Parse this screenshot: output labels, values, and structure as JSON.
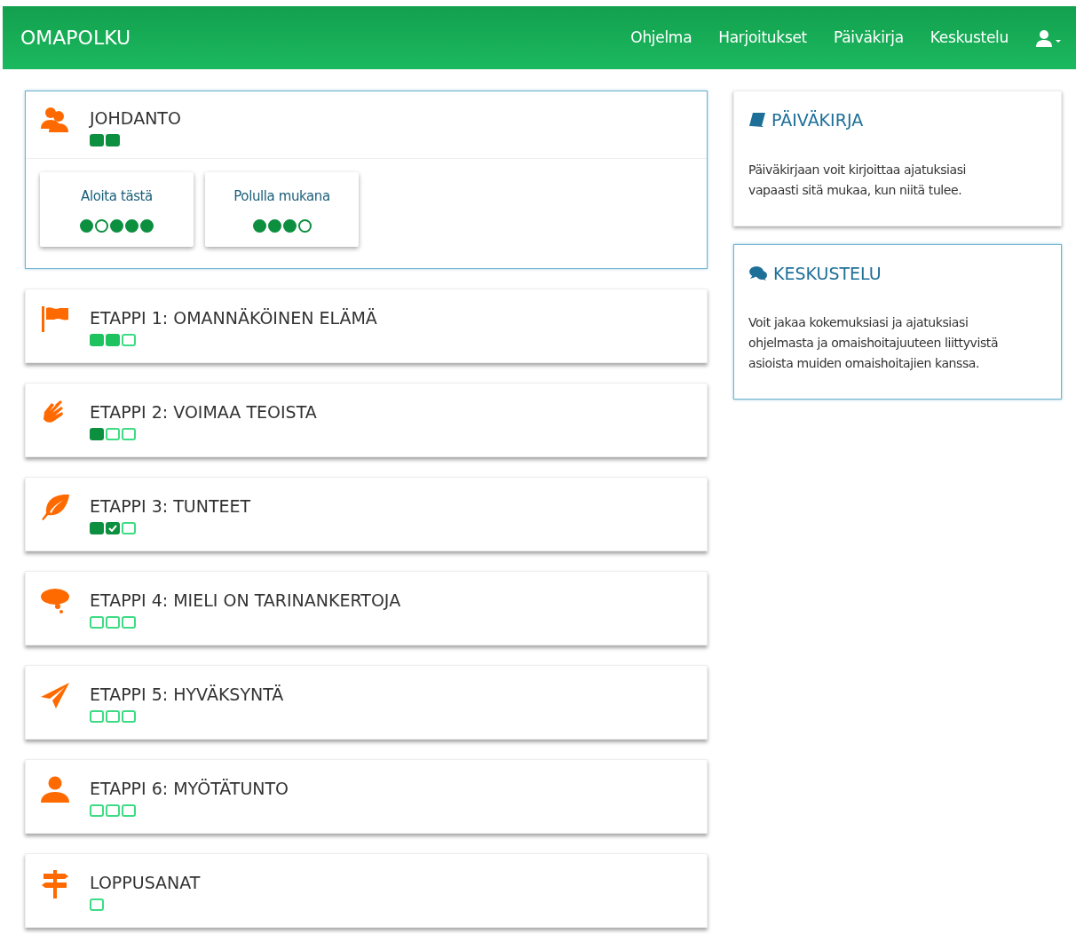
{
  "navbar": {
    "brand": "OMAPOLKU",
    "links": [
      "Ohjelma",
      "Harjoitukset",
      "Päiväkirja",
      "Keskustelu"
    ]
  },
  "stages": [
    {
      "title": "JOHDANTO",
      "highlighted": true,
      "progress": [
        {
          "kind": "done"
        },
        {
          "kind": "done"
        }
      ],
      "lessons": [
        {
          "label": "Aloita tästä",
          "dots": [
            {
              "filled": true
            },
            {
              "filled": false
            },
            {
              "filled": true
            },
            {
              "filled": true
            },
            {
              "filled": true
            }
          ]
        },
        {
          "label": "Polulla mukana",
          "dots": [
            {
              "filled": true
            },
            {
              "filled": true
            },
            {
              "filled": true
            },
            {
              "filled": false
            }
          ]
        }
      ]
    },
    {
      "title": "ETAPPI 1: OMANNÄKÖINEN ELÄMÄ",
      "highlighted": false,
      "progress": [
        {
          "kind": "active"
        },
        {
          "kind": "active"
        },
        {
          "kind": "empty"
        }
      ]
    },
    {
      "title": "ETAPPI 2: VOIMAA TEOISTA",
      "highlighted": false,
      "progress": [
        {
          "kind": "done"
        },
        {
          "kind": "empty"
        },
        {
          "kind": "empty"
        }
      ]
    },
    {
      "title": "ETAPPI 3: TUNTEET",
      "highlighted": false,
      "progress": [
        {
          "kind": "done"
        },
        {
          "kind": "checked"
        },
        {
          "kind": "empty"
        }
      ]
    },
    {
      "title": "ETAPPI 4: MIELI ON TARINANKERTOJA",
      "highlighted": false,
      "progress": [
        {
          "kind": "empty"
        },
        {
          "kind": "empty"
        },
        {
          "kind": "empty"
        }
      ]
    },
    {
      "title": "ETAPPI 5: HYVÄKSYNTÄ",
      "highlighted": false,
      "progress": [
        {
          "kind": "empty"
        },
        {
          "kind": "empty"
        },
        {
          "kind": "empty"
        }
      ]
    },
    {
      "title": "ETAPPI 6: MYÖTÄTUNTO",
      "highlighted": false,
      "progress": [
        {
          "kind": "empty"
        },
        {
          "kind": "empty"
        },
        {
          "kind": "empty"
        }
      ]
    },
    {
      "title": "LOPPUSANAT",
      "highlighted": false,
      "progress": [
        {
          "kind": "empty"
        }
      ]
    }
  ],
  "side_cards": [
    {
      "title": "PÄIVÄKIRJA",
      "text": "Päiväkirjaan voit kirjoittaa ajatuksiasi vapaasti sitä mukaa, kun niitä tulee.",
      "highlighted": false
    },
    {
      "title": "KESKUSTELU",
      "text": "Voit jakaa kokemuksiasi ja ajatuksiasi ohjelmasta ja omaishoitajuuteen liittyvistä asioista muiden omaishoitajien kanssa.",
      "highlighted": true
    }
  ]
}
